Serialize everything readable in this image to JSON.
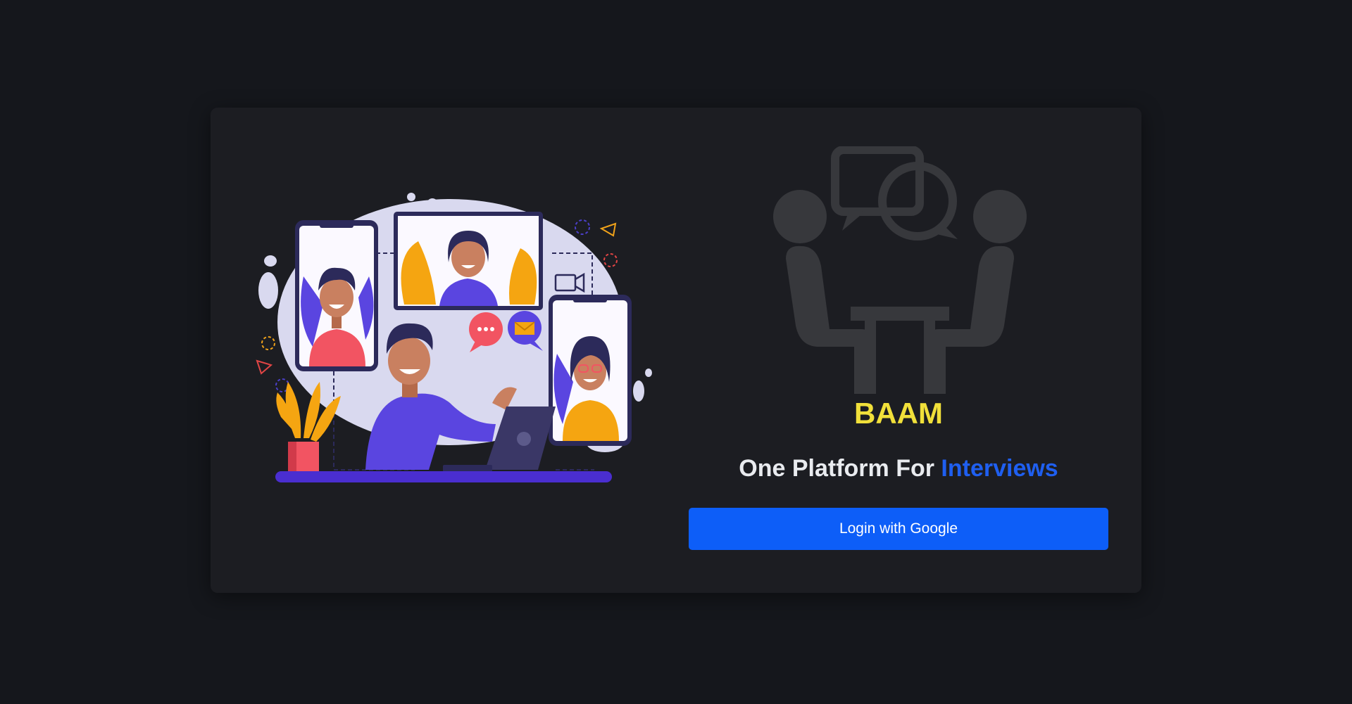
{
  "brand": {
    "name": "BAAM",
    "tagline_prefix": "One Platform For ",
    "tagline_accent": "Interviews"
  },
  "auth": {
    "login_button_label": "Login with Google"
  },
  "icons": {
    "hero": "video-call-illustration",
    "logo": "interview-meeting-icon"
  },
  "colors": {
    "background": "#15171c",
    "card": "#1c1d22",
    "brand_name": "#f1e03a",
    "accent": "#1f5ff0",
    "button": "#0d5ef8"
  }
}
